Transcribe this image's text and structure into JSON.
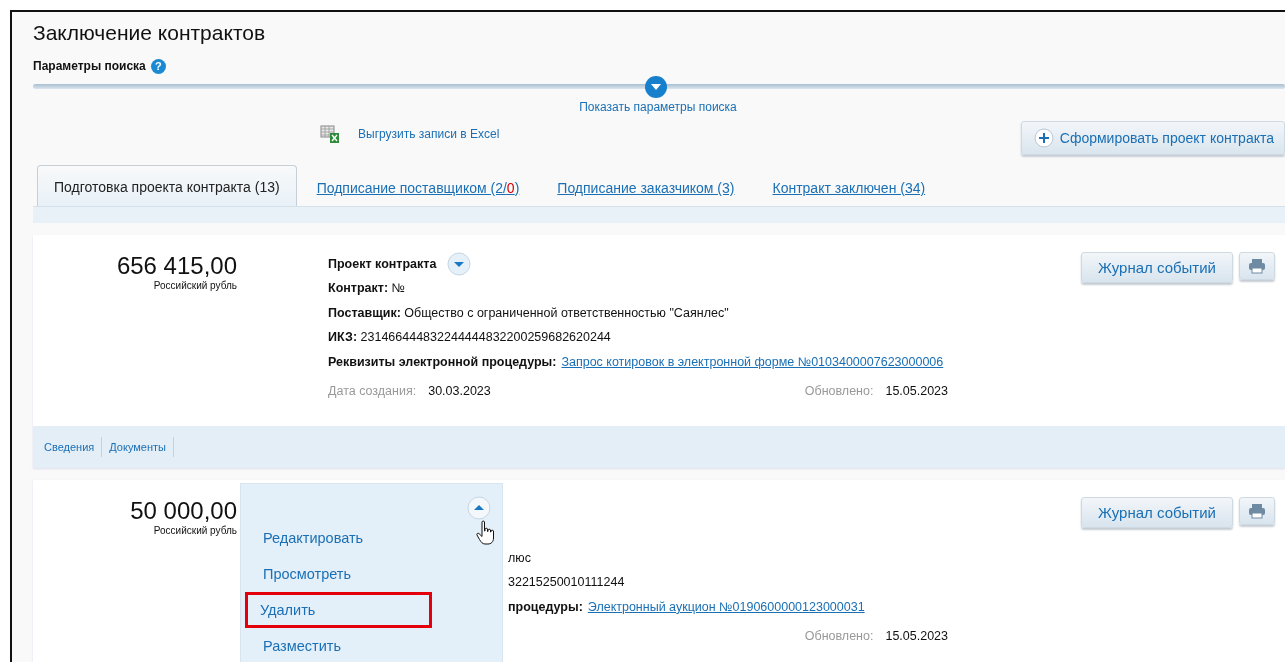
{
  "page_title": "Заключение контрактов",
  "search_params": {
    "label": "Параметры поиска",
    "help_icon": "?",
    "toggle_label": "Показать параметры поиска",
    "expanded": false
  },
  "toolbar": {
    "export_label": "Выгрузить записи в Excel",
    "create_button": "Сформировать проект контракта"
  },
  "tabs": [
    {
      "selected": true,
      "parts": [
        {
          "text": "Подготовка проекта контракта (13)",
          "alert": false
        }
      ]
    },
    {
      "selected": false,
      "parts": [
        {
          "text": "Подписание поставщиком (2/",
          "alert": false
        },
        {
          "text": "0",
          "alert": true
        },
        {
          "text": ")",
          "alert": false
        }
      ]
    },
    {
      "selected": false,
      "parts": [
        {
          "text": "Подписание заказчиком (3)",
          "alert": false
        }
      ]
    },
    {
      "selected": false,
      "parts": [
        {
          "text": "Контракт заключен (34)",
          "alert": false
        }
      ]
    }
  ],
  "cards": [
    {
      "amount": "656 415,00",
      "currency": "Российский рубль",
      "title": "Проект контракта",
      "expanded": false,
      "fields": [
        {
          "kind": "text",
          "label": "Контракт:",
          "value": "№"
        },
        {
          "kind": "text",
          "label": "Поставщик:",
          "value": "Общество с ограниченной ответственностью \"Саянлес\""
        },
        {
          "kind": "text",
          "label": "ИКЗ:",
          "value": "231466444832244444832200259682620244"
        },
        {
          "kind": "link",
          "label": "Реквизиты электронной процедуры:",
          "value": "Запрос котировок в электронной форме №0103400007623000006"
        }
      ],
      "created_label": "Дата создания:",
      "created": "30.03.2023",
      "updated_label": "Обновлено:",
      "updated": "15.05.2023",
      "journal_button": "Журнал событий",
      "footer_tabs": [
        "Сведения",
        "Документы"
      ]
    },
    {
      "amount": "50 000,00",
      "currency": "Российский рубль",
      "expanded": true,
      "menu": [
        {
          "label": "Редактировать",
          "highlighted": false
        },
        {
          "label": "Просмотреть",
          "highlighted": false
        },
        {
          "label": "Удалить",
          "highlighted": true
        },
        {
          "label": "Разместить",
          "highlighted": false
        }
      ],
      "fields": [
        {
          "kind": "text",
          "value": "люс"
        },
        {
          "kind": "text",
          "value": "32215250010111244"
        },
        {
          "kind": "link",
          "label": "процедуры:",
          "value": "Электронный аукцион №0190600000123000031"
        }
      ],
      "updated_label": "Обновлено:",
      "updated": "15.05.2023",
      "journal_button": "Журнал событий"
    }
  ]
}
